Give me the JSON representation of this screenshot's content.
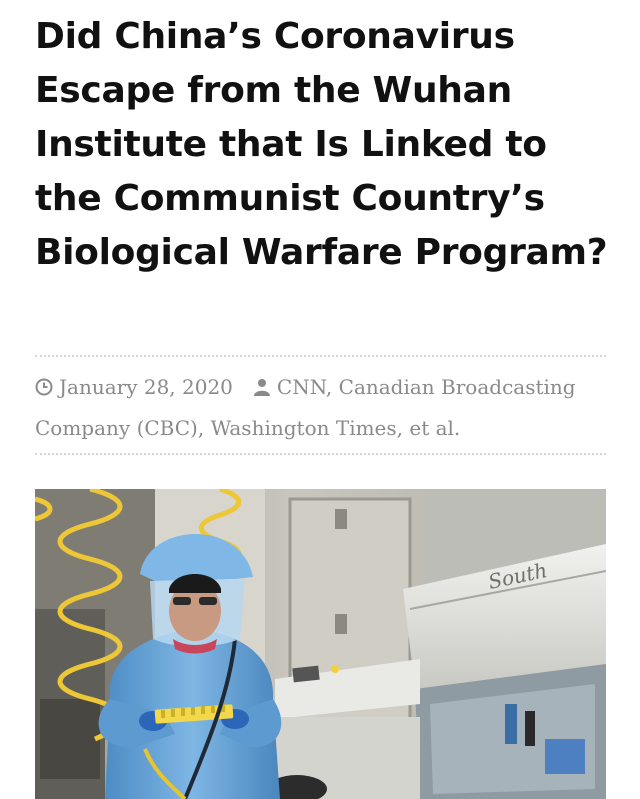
{
  "article": {
    "title": "Did China’s Coronavirus Escape from the Wuhan Institute that Is Linked to the Communist Country’s Biological Warfare Program?",
    "date": "January 28, 2020",
    "author": "CNN, Canadian Broadcasting Company (CBC), Washington Times, et al.",
    "icons": {
      "date": "clock-icon",
      "author": "user-icon"
    }
  },
  "photo": {
    "cabinet_label": "South",
    "colors": {
      "suit": "#6aa6d8",
      "hood": "#7fb8e6",
      "tube": "#f1d23a",
      "wall": "#c9c7bf",
      "cabinet": "#e6e6e3"
    }
  }
}
